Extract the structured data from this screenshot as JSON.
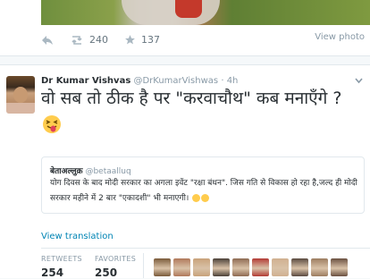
{
  "top_tweet": {
    "retweets": "240",
    "favorites": "137",
    "view_photo": "View photo"
  },
  "tweet": {
    "name": "Dr Kumar Vishvas",
    "handle": "@DrKumarVishwas",
    "separator": "·",
    "time": "4h",
    "text": "वो सब तो ठीक है पर \"करवाचौथ\" कब मनाएँगे ?",
    "quote": {
      "name": "बेताअल्लुक़",
      "handle": "@betaalluq",
      "text": "योग दिवस के बाद मोदी सरकार का अगला इवेंट \"रक्षा बंधन\". जिस गति से विकास हो रहा है,जल्द ही मोदी सरकार महीने में 2 बार \"एकादशी\" भी मनाएगी।"
    },
    "view_translation": "View translation",
    "stats": {
      "retweets_label": "RETWEETS",
      "retweets_value": "254",
      "favorites_label": "FAVORITES",
      "favorites_value": "250"
    },
    "favoriter_colors": [
      "#7a5a3a",
      "#b0785a",
      "#c8a27a",
      "#4a4038",
      "#8e6a52",
      "#b23a34",
      "#d0b090",
      "#5a4a40",
      "#9c7c60",
      "#6a5040"
    ]
  },
  "colors": {
    "link": "#0084b4",
    "muted": "#8899a6",
    "text": "#292f33"
  }
}
